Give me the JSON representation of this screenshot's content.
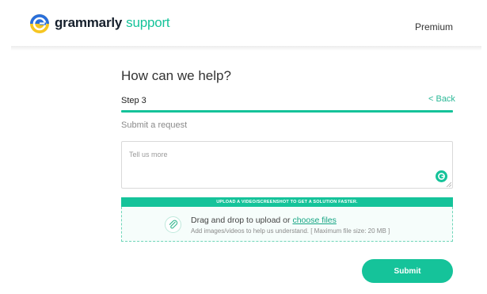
{
  "header": {
    "brand": "grammarly",
    "brand_accent": "support",
    "premium_link": "Premium",
    "logo_icon": "grammarly-logo-icon"
  },
  "form": {
    "title": "How can we help?",
    "step_label": "Step 3",
    "back_link": "< Back",
    "progress_fraction": 1.0,
    "section_label": "Submit a request",
    "message": {
      "placeholder": "Tell us more",
      "value": ""
    },
    "upload": {
      "banner": "UPLOAD A VIDEO/SCREENSHOT TO GET A SOLUTION FASTER.",
      "drop_text": "Drag and drop to upload or",
      "choose_files": "choose files",
      "hint": "Add images/videos to help us understand. [ Maximum file size: 20 MB ]",
      "icon": "paperclip-icon"
    },
    "submit_label": "Submit"
  },
  "colors": {
    "accent": "#15c39a",
    "brand_text": "#16202c",
    "logo_blue": "#2a6fdb",
    "logo_yellow": "#f6c622"
  }
}
